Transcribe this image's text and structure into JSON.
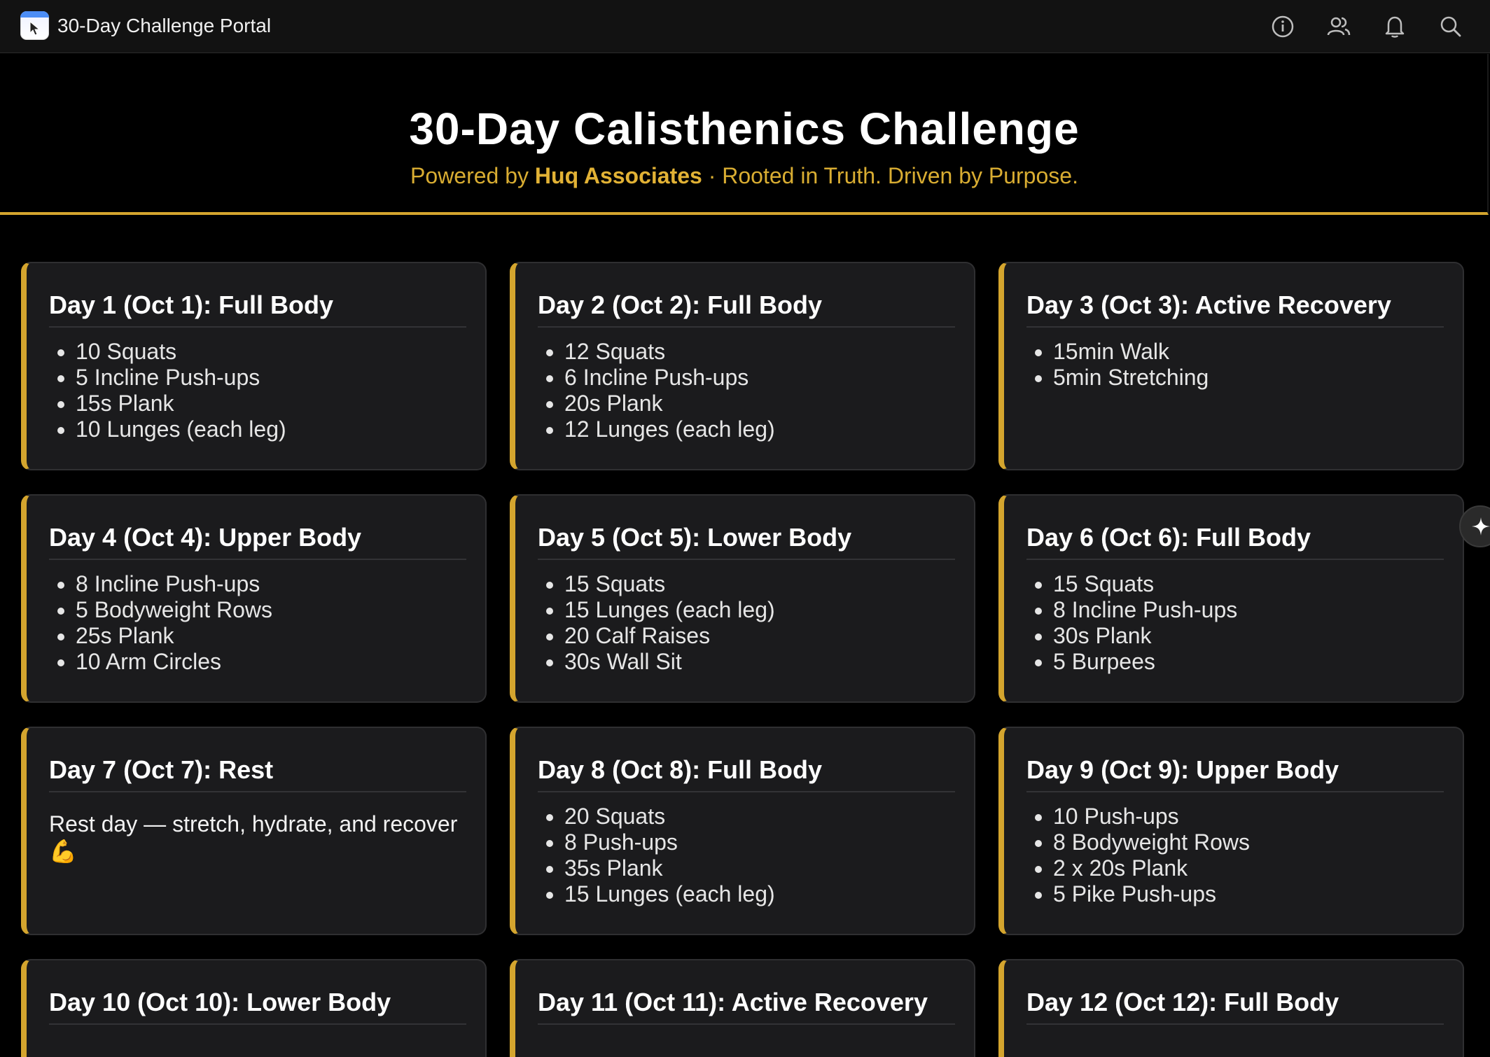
{
  "window": {
    "title": "30-Day Challenge Portal",
    "app_icon": "app-window-icon",
    "toolbar_icons": [
      "info-icon",
      "people-icon",
      "bell-icon",
      "search-icon"
    ]
  },
  "hero": {
    "title": "30-Day Calisthenics Challenge",
    "subtitle_prefix": "Powered by ",
    "subtitle_brand": "Huq Associates",
    "subtitle_suffix": " · Rooted in Truth. Driven by Purpose."
  },
  "colors": {
    "accent": "#d4a52e",
    "background": "#000000",
    "card": "#1b1b1d"
  },
  "days": [
    {
      "title": "Day 1 (Oct 1): Full Body",
      "items": [
        "10 Squats",
        "5 Incline Push-ups",
        "15s Plank",
        "10 Lunges (each leg)"
      ]
    },
    {
      "title": "Day 2 (Oct 2): Full Body",
      "items": [
        "12 Squats",
        "6 Incline Push-ups",
        "20s Plank",
        "12 Lunges (each leg)"
      ]
    },
    {
      "title": "Day 3 (Oct 3): Active Recovery",
      "items": [
        "15min Walk",
        "5min Stretching"
      ]
    },
    {
      "title": "Day 4 (Oct 4): Upper Body",
      "items": [
        "8 Incline Push-ups",
        "5 Bodyweight Rows",
        "25s Plank",
        "10 Arm Circles"
      ]
    },
    {
      "title": "Day 5 (Oct 5): Lower Body",
      "items": [
        "15 Squats",
        "15 Lunges (each leg)",
        "20 Calf Raises",
        "30s Wall Sit"
      ]
    },
    {
      "title": "Day 6 (Oct 6): Full Body",
      "items": [
        "15 Squats",
        "8 Incline Push-ups",
        "30s Plank",
        "5 Burpees"
      ]
    },
    {
      "title": "Day 7 (Oct 7): Rest",
      "text": "Rest day — stretch, hydrate, and recover 💪"
    },
    {
      "title": "Day 8 (Oct 8): Full Body",
      "items": [
        "20 Squats",
        "8 Push-ups",
        "35s Plank",
        "15 Lunges (each leg)"
      ]
    },
    {
      "title": "Day 9 (Oct 9): Upper Body",
      "items": [
        "10 Push-ups",
        "8 Bodyweight Rows",
        "2 x 20s Plank",
        "5 Pike Push-ups"
      ]
    },
    {
      "title": "Day 10 (Oct 10): Lower Body",
      "items": []
    },
    {
      "title": "Day 11 (Oct 11): Active Recovery",
      "items": []
    },
    {
      "title": "Day 12 (Oct 12): Full Body",
      "items": []
    }
  ],
  "fab": {
    "icon": "sparkle-icon"
  }
}
